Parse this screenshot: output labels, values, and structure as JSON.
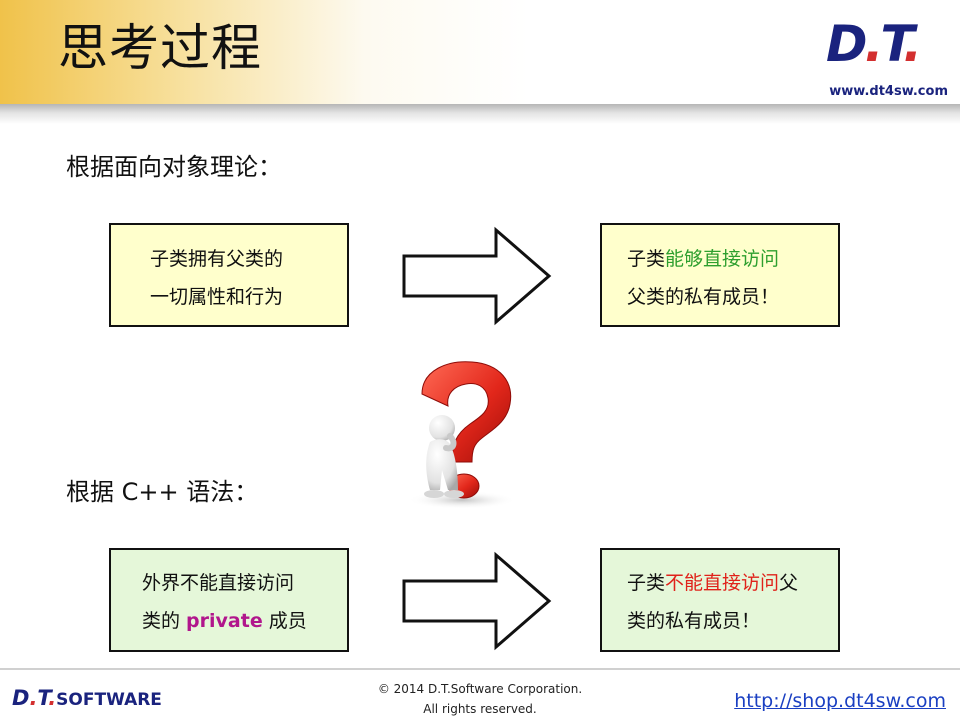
{
  "header": {
    "title": "思考过程",
    "logo": {
      "d": "D",
      "dot1": ".",
      "t": "T",
      "dot2": "."
    },
    "logo_url": "www.dt4sw.com"
  },
  "section1": {
    "label": "根据面向对象理论：",
    "left_box": {
      "line1": "子类拥有父类的",
      "line2": "一切属性和行为"
    },
    "right_box": {
      "line1_pre": "子类",
      "line1_green": "能够直接访问",
      "line2": "父类的私有成员！"
    }
  },
  "section2": {
    "label": "根据 C++ 语法：",
    "left_box": {
      "line1": "外界不能直接访问",
      "line2_pre": "类的 ",
      "line2_purple": "private",
      "line2_post": " 成员"
    },
    "right_box": {
      "line1_pre": "子类",
      "line1_red": "不能直接访问",
      "line1_post": "父",
      "line2": "类的私有成员！"
    }
  },
  "footer": {
    "logo_d": "D",
    "logo_dot": ".",
    "logo_t": "T",
    "logo_dot2": ".",
    "logo_software": "SOFTWARE",
    "copyright_line1": "© 2014 D.T.Software Corporation.",
    "copyright_line2": "All rights reserved.",
    "link": "http://shop.dt4sw.com"
  },
  "colors": {
    "accent_green": "#2e9f2e",
    "accent_red": "#e0221a",
    "accent_purple": "#b1168c",
    "box_yellow": "#ffffcc",
    "box_green": "#e5f7d9",
    "brand_blue": "#1a237e"
  }
}
